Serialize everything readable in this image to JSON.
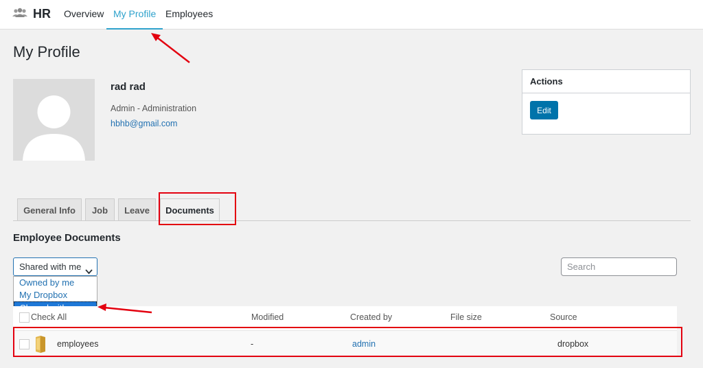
{
  "nav": {
    "brand": "HR",
    "items": [
      "Overview",
      "My Profile",
      "Employees"
    ],
    "active": "My Profile"
  },
  "page": {
    "title": "My Profile"
  },
  "profile": {
    "name": "rad rad",
    "role": "Admin - Administration",
    "email": "hbhb@gmail.com"
  },
  "actions": {
    "title": "Actions",
    "edit_label": "Edit"
  },
  "tabs": [
    "General Info",
    "Job",
    "Leave",
    "Documents"
  ],
  "active_tab": "Documents",
  "documents": {
    "title": "Employee Documents",
    "filter_selected": "Shared with me",
    "filter_options": [
      "Owned by me",
      "My Dropbox",
      "Shared with me"
    ],
    "search_placeholder": "Search",
    "columns": [
      "Check All",
      "Modified",
      "Created by",
      "File size",
      "Source"
    ],
    "rows": [
      {
        "name": "employees",
        "modified": "-",
        "created_by": "admin",
        "file_size": "",
        "source": "dropbox"
      }
    ]
  },
  "colors": {
    "accent": "#2ea2cc",
    "button": "#0073aa",
    "highlight": "#e3000f",
    "select_bg": "#1e78d7"
  },
  "icons": {
    "brand": "users-icon",
    "folder": "folder-icon",
    "dropdown": "chevron-down-icon"
  }
}
